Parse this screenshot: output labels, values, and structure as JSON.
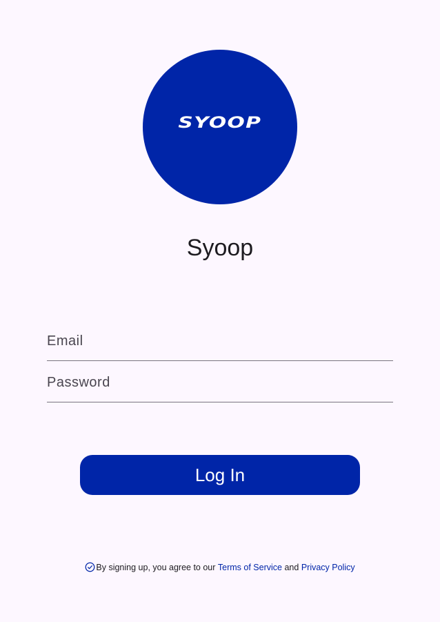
{
  "logo": {
    "wordmark": "SYOOP"
  },
  "app": {
    "title": "Syoop"
  },
  "form": {
    "email_placeholder": "Email",
    "password_placeholder": "Password",
    "login_label": "Log In"
  },
  "agreement": {
    "prefix": "By signing up, you agree to our ",
    "terms_label": "Terms of Service",
    "conjunction": " and ",
    "privacy_label": "Privacy Policy"
  },
  "icons": {
    "agreement_icon": "check-circle-icon"
  },
  "colors": {
    "background": "#fdf7ff",
    "primary": "#0025a8",
    "text": "#1d1b20",
    "field_line": "#79747e"
  }
}
